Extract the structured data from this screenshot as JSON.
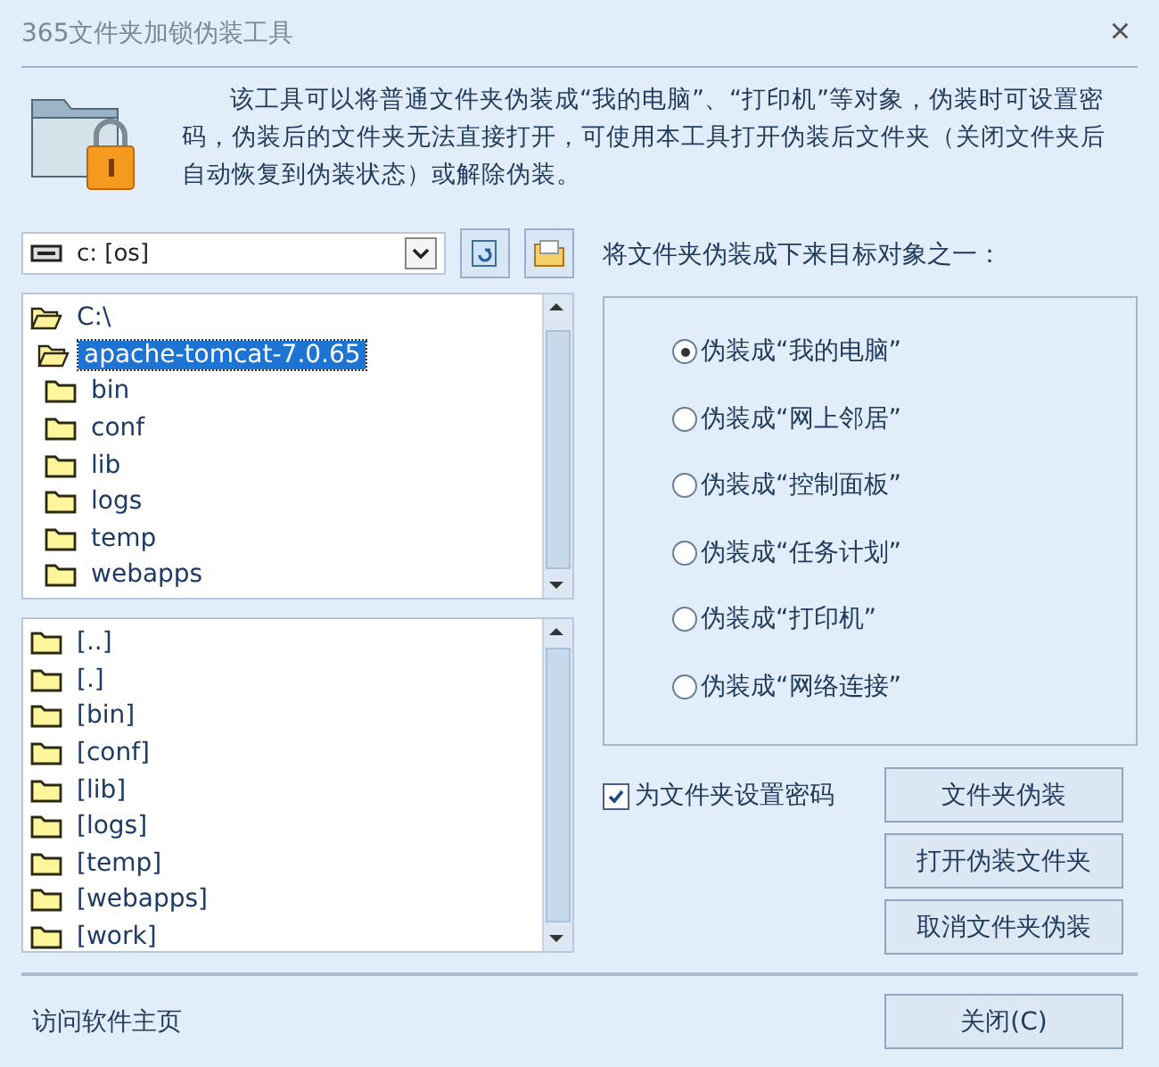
{
  "window": {
    "title": "365文件夹加锁伪装工具",
    "close": "×"
  },
  "description": "该工具可以将普通文件夹伪装成“我的电脑”、“打印机”等对象，伪装时可设置密码，伪装后的文件夹无法直接打开，可使用本工具打开伪装后文件夹（关闭文件夹后自动恢复到伪装状态）或解除伪装。",
  "drive": {
    "value": "c: [os]"
  },
  "folder_tree": [
    {
      "label": "C:\\",
      "expanded": true,
      "selected": false,
      "children": [
        {
          "label": "apache-tomcat-7.0.65",
          "expanded": true,
          "selected": true,
          "children": [
            {
              "label": "bin",
              "expanded": false,
              "selected": false
            },
            {
              "label": "conf",
              "expanded": false,
              "selected": false
            },
            {
              "label": "lib",
              "expanded": false,
              "selected": false
            },
            {
              "label": "logs",
              "expanded": false,
              "selected": false
            },
            {
              "label": "temp",
              "expanded": false,
              "selected": false
            },
            {
              "label": "webapps",
              "expanded": false,
              "selected": false
            }
          ]
        }
      ]
    }
  ],
  "file_list": [
    "[..]",
    "[.]",
    "[bin]",
    "[conf]",
    "[lib]",
    "[logs]",
    "[temp]",
    "[webapps]",
    "[work]"
  ],
  "target_label": "将文件夹伪装成下来目标对象之一：",
  "targets": [
    {
      "label": "伪装成“我的电脑”",
      "selected": true
    },
    {
      "label": "伪装成“网上邻居”",
      "selected": false
    },
    {
      "label": "伪装成“控制面板”",
      "selected": false
    },
    {
      "label": "伪装成“任务计划”",
      "selected": false
    },
    {
      "label": "伪装成“打印机”",
      "selected": false
    },
    {
      "label": "伪装成“网络连接”",
      "selected": false
    }
  ],
  "password": {
    "label": "为文件夹设置密码",
    "checked": true
  },
  "actions": [
    "文件夹伪装",
    "打开伪装文件夹",
    "取消文件夹伪装"
  ],
  "homepage_link": "访问软件主页",
  "close_button": "关闭(C)"
}
